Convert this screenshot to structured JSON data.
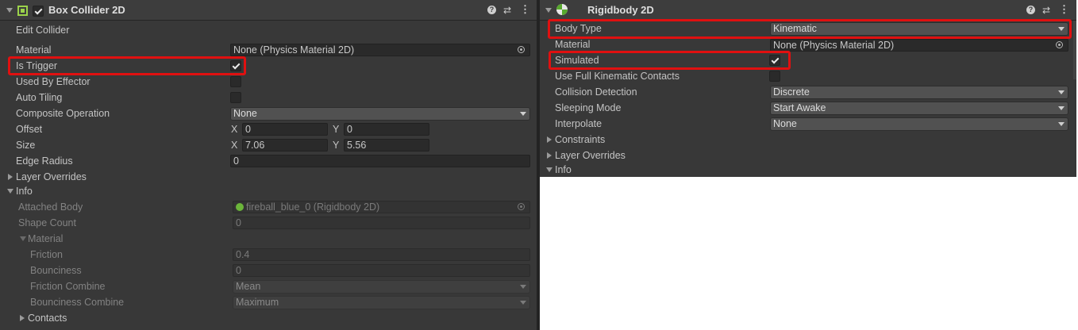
{
  "box_collider": {
    "title": "Box Collider 2D",
    "enabled": true,
    "edit_collider_label": "Edit Collider",
    "material_label": "Material",
    "material_value": "None (Physics Material 2D)",
    "is_trigger_label": "Is Trigger",
    "is_trigger_checked": true,
    "used_by_effector_label": "Used By Effector",
    "auto_tiling_label": "Auto Tiling",
    "composite_operation_label": "Composite Operation",
    "composite_operation_value": "None",
    "offset_label": "Offset",
    "offset_x": "0",
    "offset_y": "0",
    "size_label": "Size",
    "size_x": "7.06",
    "size_y": "5.56",
    "x_label": "X",
    "y_label": "Y",
    "edge_radius_label": "Edge Radius",
    "edge_radius_value": "0",
    "layer_overrides_label": "Layer Overrides",
    "info_label": "Info",
    "attached_body_label": "Attached Body",
    "attached_body_value": "fireball_blue_0 (Rigidbody 2D)",
    "shape_count_label": "Shape Count",
    "shape_count_value": "0",
    "material_section_label": "Material",
    "friction_label": "Friction",
    "friction_value": "0.4",
    "bounciness_label": "Bounciness",
    "bounciness_value": "0",
    "friction_combine_label": "Friction Combine",
    "friction_combine_value": "Mean",
    "bounciness_combine_label": "Bounciness Combine",
    "bounciness_combine_value": "Maximum",
    "contacts_label": "Contacts"
  },
  "rigidbody": {
    "title": "Rigidbody 2D",
    "body_type_label": "Body Type",
    "body_type_value": "Kinematic",
    "material_label": "Material",
    "material_value": "None (Physics Material 2D)",
    "simulated_label": "Simulated",
    "simulated_checked": true,
    "full_kinematic_label": "Use Full Kinematic Contacts",
    "collision_detection_label": "Collision Detection",
    "collision_detection_value": "Discrete",
    "sleeping_mode_label": "Sleeping Mode",
    "sleeping_mode_value": "Start Awake",
    "interpolate_label": "Interpolate",
    "interpolate_value": "None",
    "constraints_label": "Constraints",
    "layer_overrides_label": "Layer Overrides",
    "info_label": "Info"
  },
  "icons": [
    "help-icon",
    "presets-icon",
    "menu-icon",
    "collider-icon",
    "rigidbody-icon",
    "object-picker-icon"
  ],
  "colors": {
    "panel_bg": "#383838",
    "highlight": "#e01010",
    "field_bg": "#2a2a2a"
  }
}
